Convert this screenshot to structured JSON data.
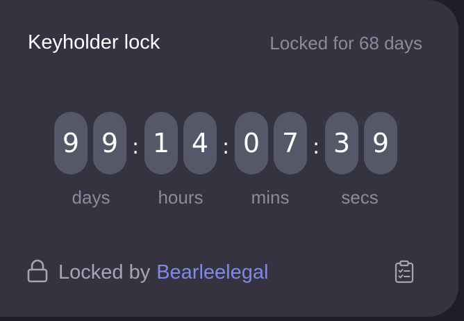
{
  "card": {
    "title": "Keyholder lock",
    "locked_duration": "Locked for 68 days"
  },
  "timer": {
    "digits": [
      "9",
      "9",
      "1",
      "4",
      "0",
      "7",
      "3",
      "9"
    ],
    "separator": ":",
    "units": [
      "days",
      "hours",
      "mins",
      "secs"
    ]
  },
  "footer": {
    "locked_by_label": "Locked by",
    "keyholder_name": "Bearleelegal"
  },
  "icons": {
    "lock": "lock-icon",
    "clipboard": "clipboard-checklist-icon"
  },
  "colors": {
    "card_background": "#35333f",
    "digit_background": "#545869",
    "muted_text": "#8d8a9c",
    "link": "#7f8ae8"
  }
}
